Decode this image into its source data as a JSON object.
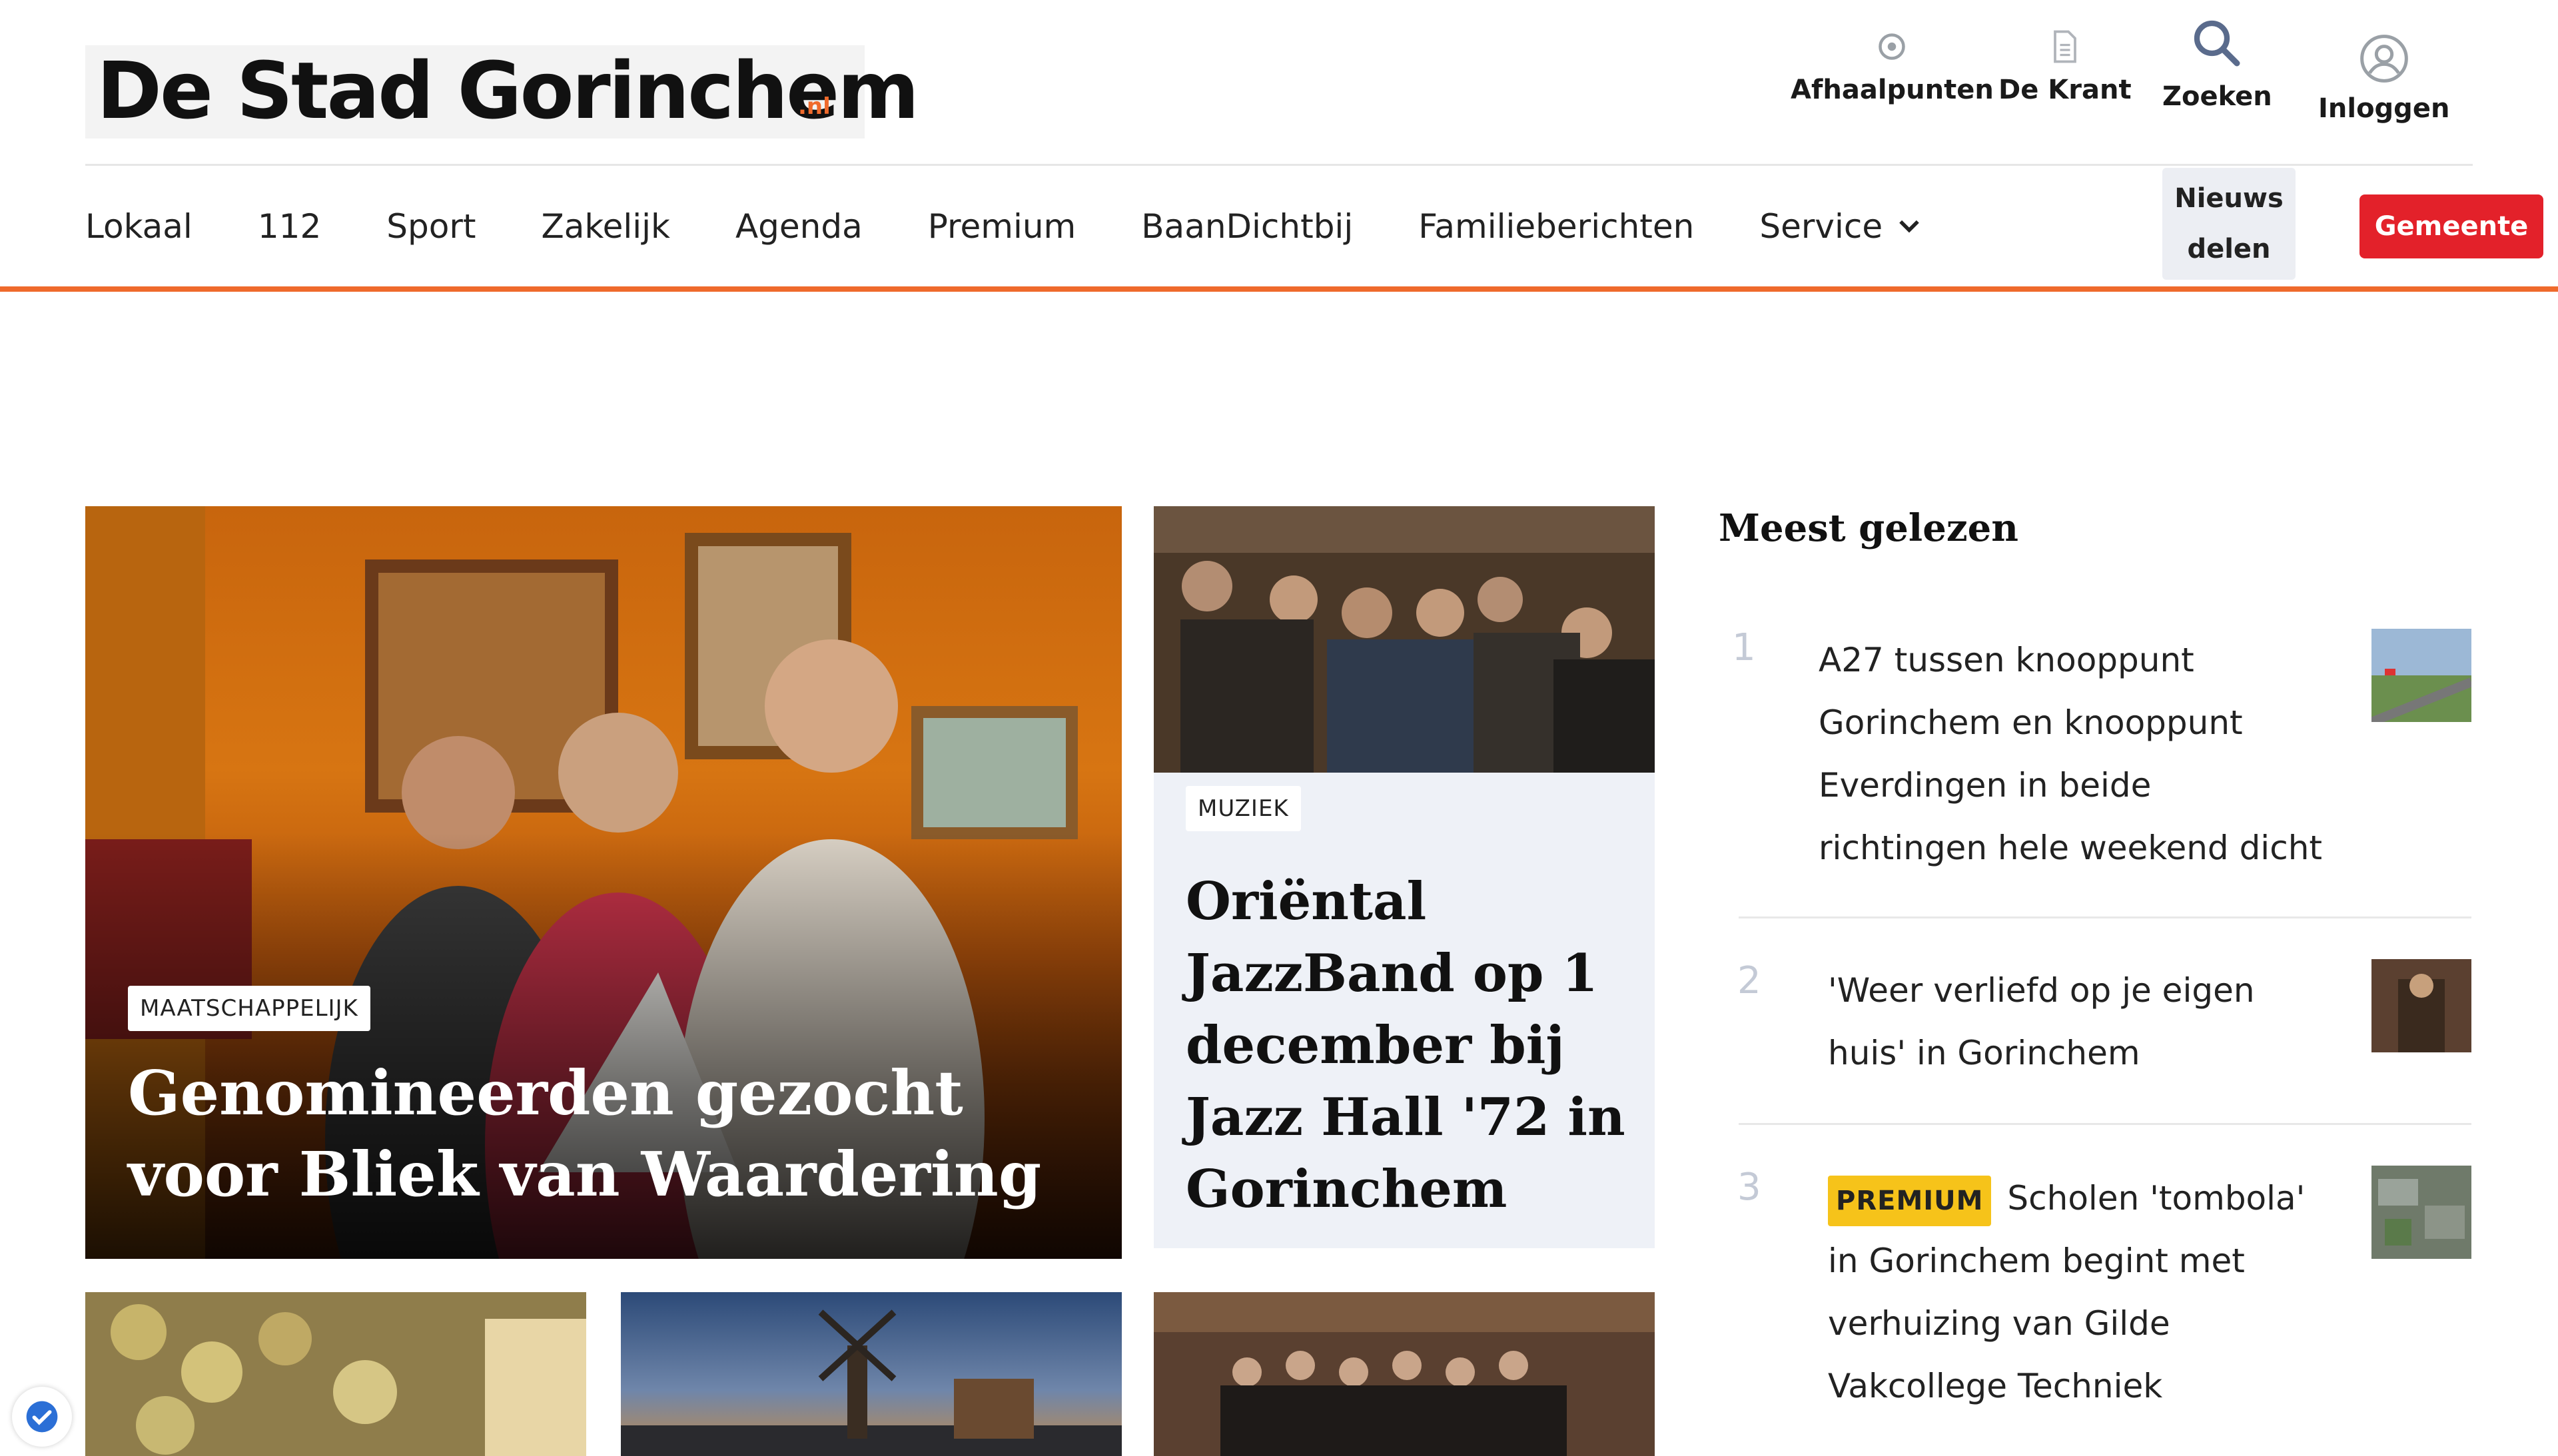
{
  "header": {
    "logo_text": "De Stad Gorinchem",
    "logo_suffix": ".nl",
    "utility": [
      {
        "label": "Afhaalpunten",
        "icon": "location-pin-icon"
      },
      {
        "label": "De Krant",
        "icon": "document-icon"
      },
      {
        "label": "Zoeken",
        "icon": "search-icon"
      },
      {
        "label": "Inloggen",
        "icon": "user-icon"
      }
    ]
  },
  "nav": {
    "items": [
      "Lokaal",
      "112",
      "Sport",
      "Zakelijk",
      "Agenda",
      "Premium",
      "BaanDichtbij",
      "Familieberichten",
      "Service"
    ],
    "share_line1": "Nieuws",
    "share_line2": "delen",
    "gemeente": "Gemeente"
  },
  "colors": {
    "accent": "#ef6a2c",
    "gemeente": "#e3212a",
    "premium": "#f6c31a"
  },
  "hero": {
    "tag": "MAATSCHAPPELIJK",
    "title": "Genomineerden gezocht voor Bliek van Waardering"
  },
  "card2": {
    "tag": "MUZIEK",
    "title": "Oriëntal JazzBand op 1 december bij Jazz Hall '72 in Gorinchem"
  },
  "sidebar": {
    "heading": "Meest gelezen",
    "items": [
      {
        "rank": "1",
        "text": "A27 tussen knooppunt Gorinchem en knooppunt Everdingen in beide richtingen hele weekend dicht"
      },
      {
        "rank": "2",
        "text": "'Weer verliefd op je eigen huis' in Gorinchem"
      },
      {
        "rank": "3",
        "badge": "PREMIUM",
        "text": "Scholen 'tombola' in Gorinchem begint met verhuizing van Gilde Vakcollege Techniek"
      }
    ]
  }
}
